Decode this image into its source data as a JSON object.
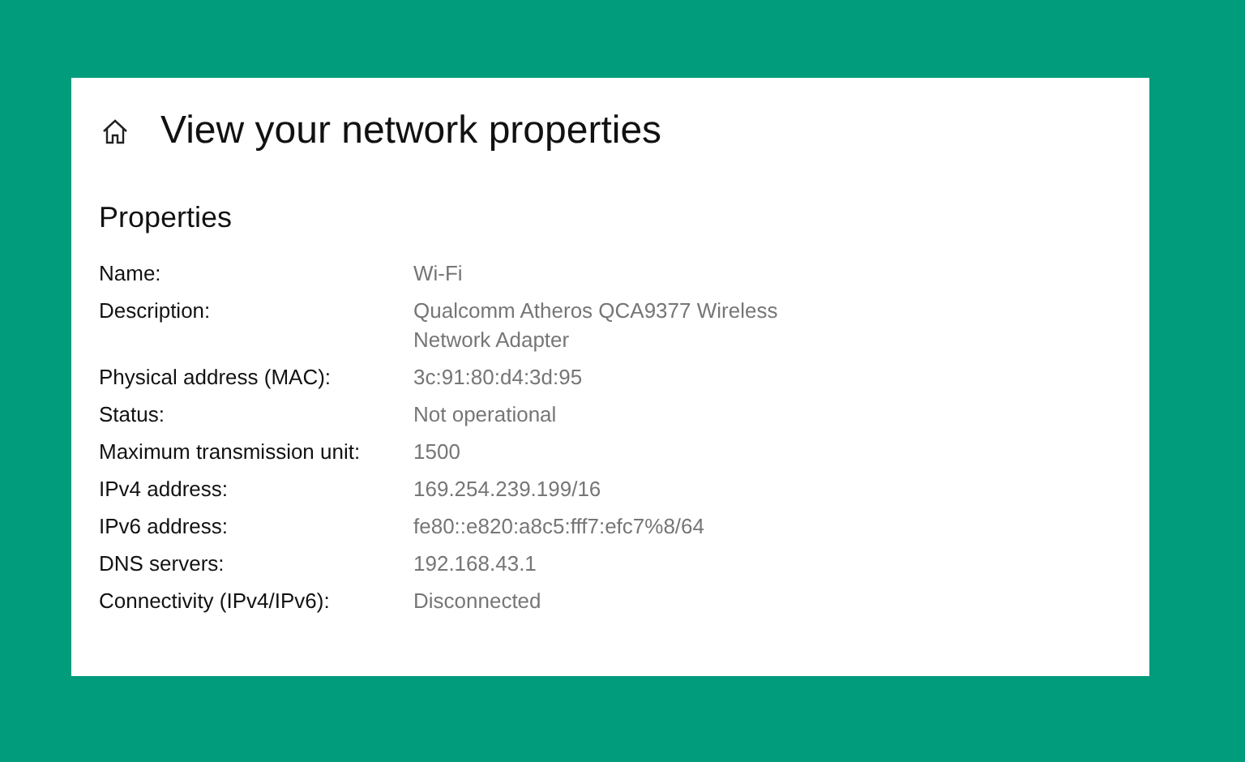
{
  "header": {
    "title": "View your network properties"
  },
  "section": {
    "title": "Properties"
  },
  "properties": [
    {
      "label": "Name:",
      "value": "Wi-Fi"
    },
    {
      "label": "Description:",
      "value": "Qualcomm Atheros QCA9377 Wireless Network Adapter"
    },
    {
      "label": "Physical address (MAC):",
      "value": "3c:91:80:d4:3d:95"
    },
    {
      "label": "Status:",
      "value": "Not operational"
    },
    {
      "label": "Maximum transmission unit:",
      "value": "1500"
    },
    {
      "label": "IPv4 address:",
      "value": "169.254.239.199/16"
    },
    {
      "label": "IPv6 address:",
      "value": "fe80::e820:a8c5:fff7:efc7%8/64"
    },
    {
      "label": "DNS servers:",
      "value": "192.168.43.1"
    },
    {
      "label": "Connectivity (IPv4/IPv6):",
      "value": "Disconnected"
    }
  ]
}
